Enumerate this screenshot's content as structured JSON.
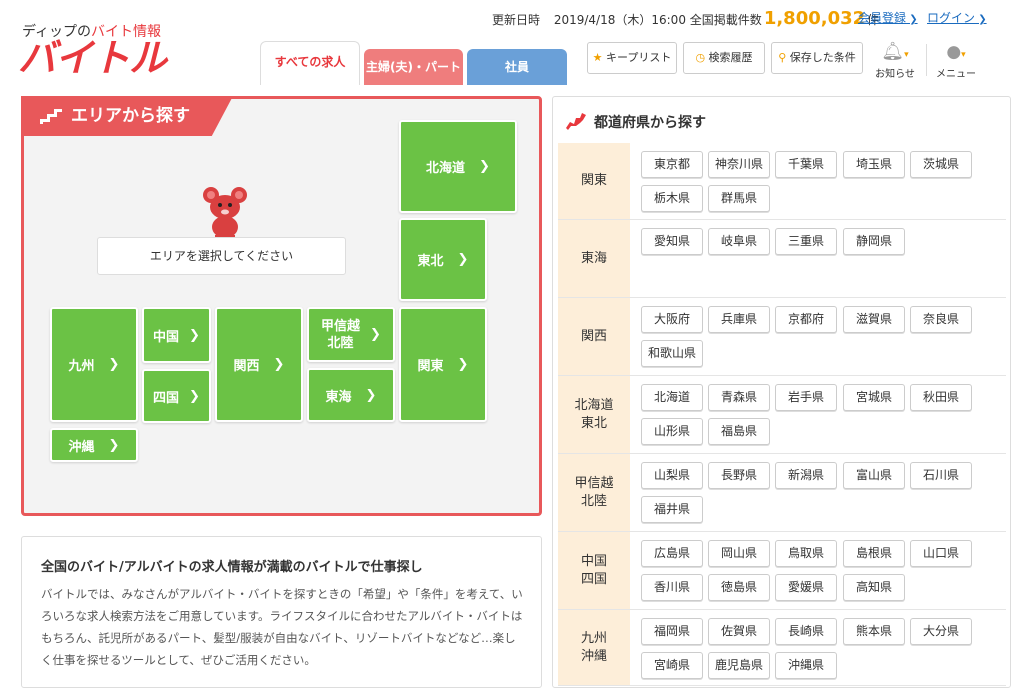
{
  "header": {
    "logo_small_prefix": "ディップの",
    "logo_small_accent": "バイト情報",
    "logo_main": "バイトル",
    "updated_label": "更新日時",
    "updated_value": "2019/4/18（木）16:00",
    "count_label": "全国掲載件数",
    "count_value": "1,800,032",
    "count_unit": "件",
    "register_link": "会員登録",
    "login_link": "ログイン"
  },
  "tabs": {
    "all": "すべての求人",
    "part": "主婦(夫)・パート",
    "employee": "社員"
  },
  "toolbar": {
    "keep_list": "キープリスト",
    "history": "検索履歴",
    "saved": "保存した条件",
    "notice": "お知らせ",
    "menu": "メニュー"
  },
  "area": {
    "title": "エリアから探す",
    "select_prompt": "エリアを選択してください",
    "regions": {
      "hokkaido": "北海道",
      "tohoku": "東北",
      "kanto": "関東",
      "koshinetsu": "甲信越\n北陸",
      "tokai": "東海",
      "kansai": "関西",
      "chugoku": "中国",
      "shikoku": "四国",
      "kyushu": "九州",
      "okinawa": "沖縄"
    }
  },
  "description": {
    "title": "全国のバイト/アルバイトの求人情報が満載のバイトルで仕事探し",
    "body": "バイトルでは、みなさんがアルバイト・バイトを探すときの「希望」や「条件」を考えて、いろいろな求人検索方法をご用意しています。ライフスタイルに合わせたアルバイト・バイトはもちろん、託児所があるパート、髪型/服装が自由なバイト、リゾートバイトなどなど…楽しく仕事を探せるツールとして、ぜひご活用ください。"
  },
  "prefectures": {
    "title": "都道府県から探す",
    "groups": [
      {
        "label": "関東",
        "items": [
          "東京都",
          "神奈川県",
          "千葉県",
          "埼玉県",
          "茨城県",
          "栃木県",
          "群馬県"
        ]
      },
      {
        "label": "東海",
        "items": [
          "愛知県",
          "岐阜県",
          "三重県",
          "静岡県"
        ]
      },
      {
        "label": "関西",
        "items": [
          "大阪府",
          "兵庫県",
          "京都府",
          "滋賀県",
          "奈良県",
          "和歌山県"
        ]
      },
      {
        "label": "北海道\n東北",
        "items": [
          "北海道",
          "青森県",
          "岩手県",
          "宮城県",
          "秋田県",
          "山形県",
          "福島県"
        ]
      },
      {
        "label": "甲信越\n北陸",
        "items": [
          "山梨県",
          "長野県",
          "新潟県",
          "富山県",
          "石川県",
          "福井県"
        ]
      },
      {
        "label": "中国\n四国",
        "items": [
          "広島県",
          "岡山県",
          "鳥取県",
          "島根県",
          "山口県",
          "香川県",
          "徳島県",
          "愛媛県",
          "高知県"
        ]
      },
      {
        "label": "九州\n沖縄",
        "items": [
          "福岡県",
          "佐賀県",
          "長崎県",
          "熊本県",
          "大分県",
          "宮崎県",
          "鹿児島県",
          "沖縄県"
        ]
      }
    ]
  },
  "colors": {
    "brand_red": "#e8383d",
    "region_green": "#6bc245",
    "count_orange": "#f0a000",
    "link_blue": "#1a6bbf"
  }
}
